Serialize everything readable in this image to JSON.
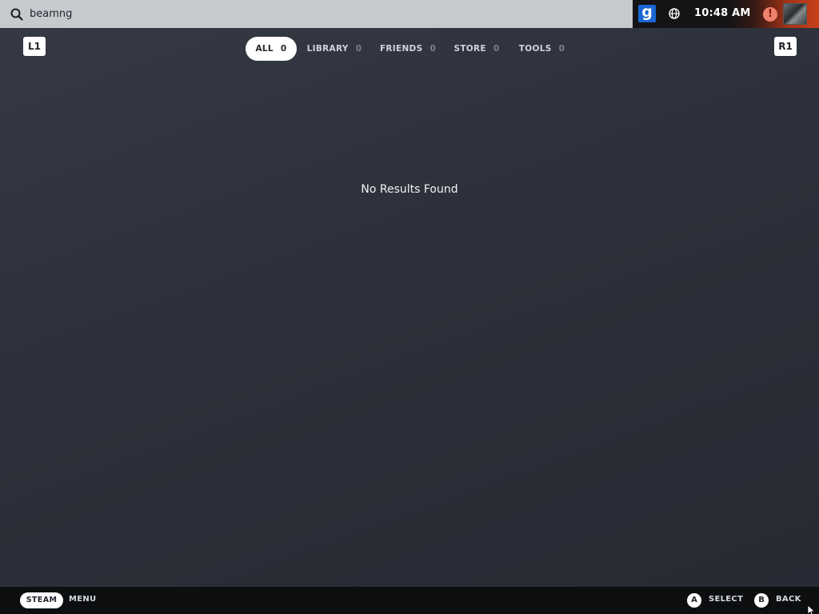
{
  "search": {
    "value": "beamng",
    "icon": "search-icon"
  },
  "status": {
    "time": "10:48 AM",
    "app_icon_letter": "g",
    "alert_symbol": "!",
    "icons": [
      "garrys-mod-icon",
      "globe-icon",
      "alert-icon",
      "avatar"
    ]
  },
  "shoulders": {
    "left": "L1",
    "right": "R1"
  },
  "tabs": [
    {
      "label": "ALL",
      "count": "0",
      "active": true
    },
    {
      "label": "LIBRARY",
      "count": "0",
      "active": false
    },
    {
      "label": "FRIENDS",
      "count": "0",
      "active": false
    },
    {
      "label": "STORE",
      "count": "0",
      "active": false
    },
    {
      "label": "TOOLS",
      "count": "0",
      "active": false
    }
  ],
  "main": {
    "message": "No Results Found"
  },
  "footer": {
    "steam_label": "STEAM",
    "menu_label": "MENU",
    "a_glyph": "A",
    "select_label": "SELECT",
    "b_glyph": "B",
    "back_label": "BACK"
  },
  "colors": {
    "background": "#2d313b",
    "searchbar": "#c6c9ce",
    "footer": "#0d0e10",
    "accent_red": "#c9401c",
    "active_tab": "#ffffff"
  }
}
